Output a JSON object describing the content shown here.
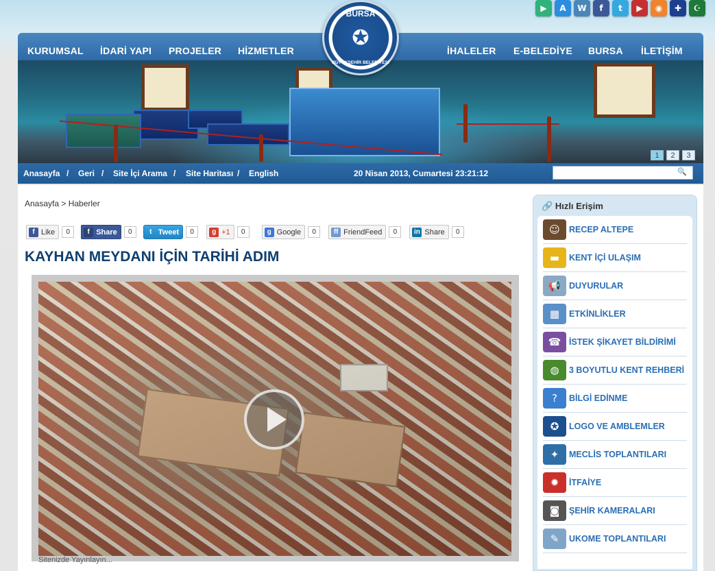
{
  "top_icons": [
    {
      "name": "google-play-icon",
      "glyph": "▶",
      "color": "#2fb37a"
    },
    {
      "name": "app-store-icon",
      "glyph": "A",
      "color": "#2a8ee0"
    },
    {
      "name": "wordpress-icon",
      "glyph": "W",
      "color": "#4a86b8"
    },
    {
      "name": "facebook-icon",
      "glyph": "f",
      "color": "#3b5998"
    },
    {
      "name": "twitter-icon",
      "glyph": "t",
      "color": "#35a8e0"
    },
    {
      "name": "youtube-icon",
      "glyph": "▶",
      "color": "#c62f2f"
    },
    {
      "name": "rss-icon",
      "glyph": "◉",
      "color": "#f0842e"
    },
    {
      "name": "english-flag-icon",
      "glyph": "✚",
      "color": "#1d3f8f"
    },
    {
      "name": "arabic-flag-icon",
      "glyph": "☪",
      "color": "#1f7a3a"
    }
  ],
  "nav": {
    "left": [
      "KURUMSAL",
      "İDARİ YAPI",
      "PROJELER",
      "HİZMETLER"
    ],
    "right": [
      "İHALELER",
      "E-BELEDİYE",
      "BURSA",
      "İLETİŞİM"
    ]
  },
  "logo": {
    "top": "BURSA",
    "bottom": "BÜYÜKŞEHİR BELEDİYESİ"
  },
  "banner": {
    "pages": [
      "1",
      "2",
      "3"
    ],
    "active_page": "1"
  },
  "subnav": {
    "links": [
      "Anasayfa",
      "Geri",
      "Site İçi Arama",
      "Site Haritası",
      "English"
    ],
    "separator": "/",
    "date": "20 Nisan 2013, Cumartesi 23:21:12",
    "search_placeholder": ""
  },
  "breadcrumb": "Anasayfa > Haberler",
  "share": {
    "like": {
      "label": "Like",
      "count": "0"
    },
    "fb_share": {
      "label": "Share",
      "count": "0"
    },
    "tweet": {
      "label": "Tweet",
      "count": "0"
    },
    "gplus": {
      "label": "+1",
      "count": "0"
    },
    "google": {
      "label": "Google",
      "count": "0"
    },
    "friendfeed": {
      "label": "FriendFeed",
      "count": "0"
    },
    "linkedin": {
      "label": "Share",
      "count": "0"
    }
  },
  "article": {
    "title": "KAYHAN MEYDANI İÇİN TARİHİ ADIM",
    "caption": "Sitenizde Yayınlayın..."
  },
  "sidebar": {
    "heading": "Hızlı Erişim",
    "items": [
      {
        "label": "RECEP ALTEPE",
        "icon": "person-photo-icon",
        "glyph": "☺",
        "color": "#6b4b2f"
      },
      {
        "label": "KENT İÇİ ULAŞIM",
        "icon": "bus-icon",
        "glyph": "▬",
        "color": "#e5b51a"
      },
      {
        "label": "DUYURULAR",
        "icon": "megaphone-icon",
        "glyph": "📢",
        "color": "#8aa9c4"
      },
      {
        "label": "ETKİNLİKLER",
        "icon": "calendar-icon",
        "glyph": "▦",
        "color": "#5b8fc7"
      },
      {
        "label": "İSTEK ŞİKAYET BİLDİRİMİ",
        "icon": "user-feedback-icon",
        "glyph": "☎",
        "color": "#7a4fa0"
      },
      {
        "label": "3 BOYUTLU KENT REHBERİ",
        "icon": "globe-icon",
        "glyph": "◍",
        "color": "#4a8a2f"
      },
      {
        "label": "BİLGİ EDİNME",
        "icon": "info-icon",
        "glyph": "?",
        "color": "#3a7fd0"
      },
      {
        "label": "LOGO VE AMBLEMLER",
        "icon": "emblem-icon",
        "glyph": "✪",
        "color": "#1d4f8f"
      },
      {
        "label": "MECLİS TOPLANTILARI",
        "icon": "assembly-icon",
        "glyph": "✦",
        "color": "#2e6fa8"
      },
      {
        "label": "İTFAİYE",
        "icon": "fire-department-icon",
        "glyph": "✹",
        "color": "#c9302c"
      },
      {
        "label": "ŞEHİR KAMERALARI",
        "icon": "camera-icon",
        "glyph": "◙",
        "color": "#555555"
      },
      {
        "label": "UKOME TOPLANTILARI",
        "icon": "ukome-icon",
        "glyph": "✎",
        "color": "#7fa6c9"
      }
    ]
  }
}
